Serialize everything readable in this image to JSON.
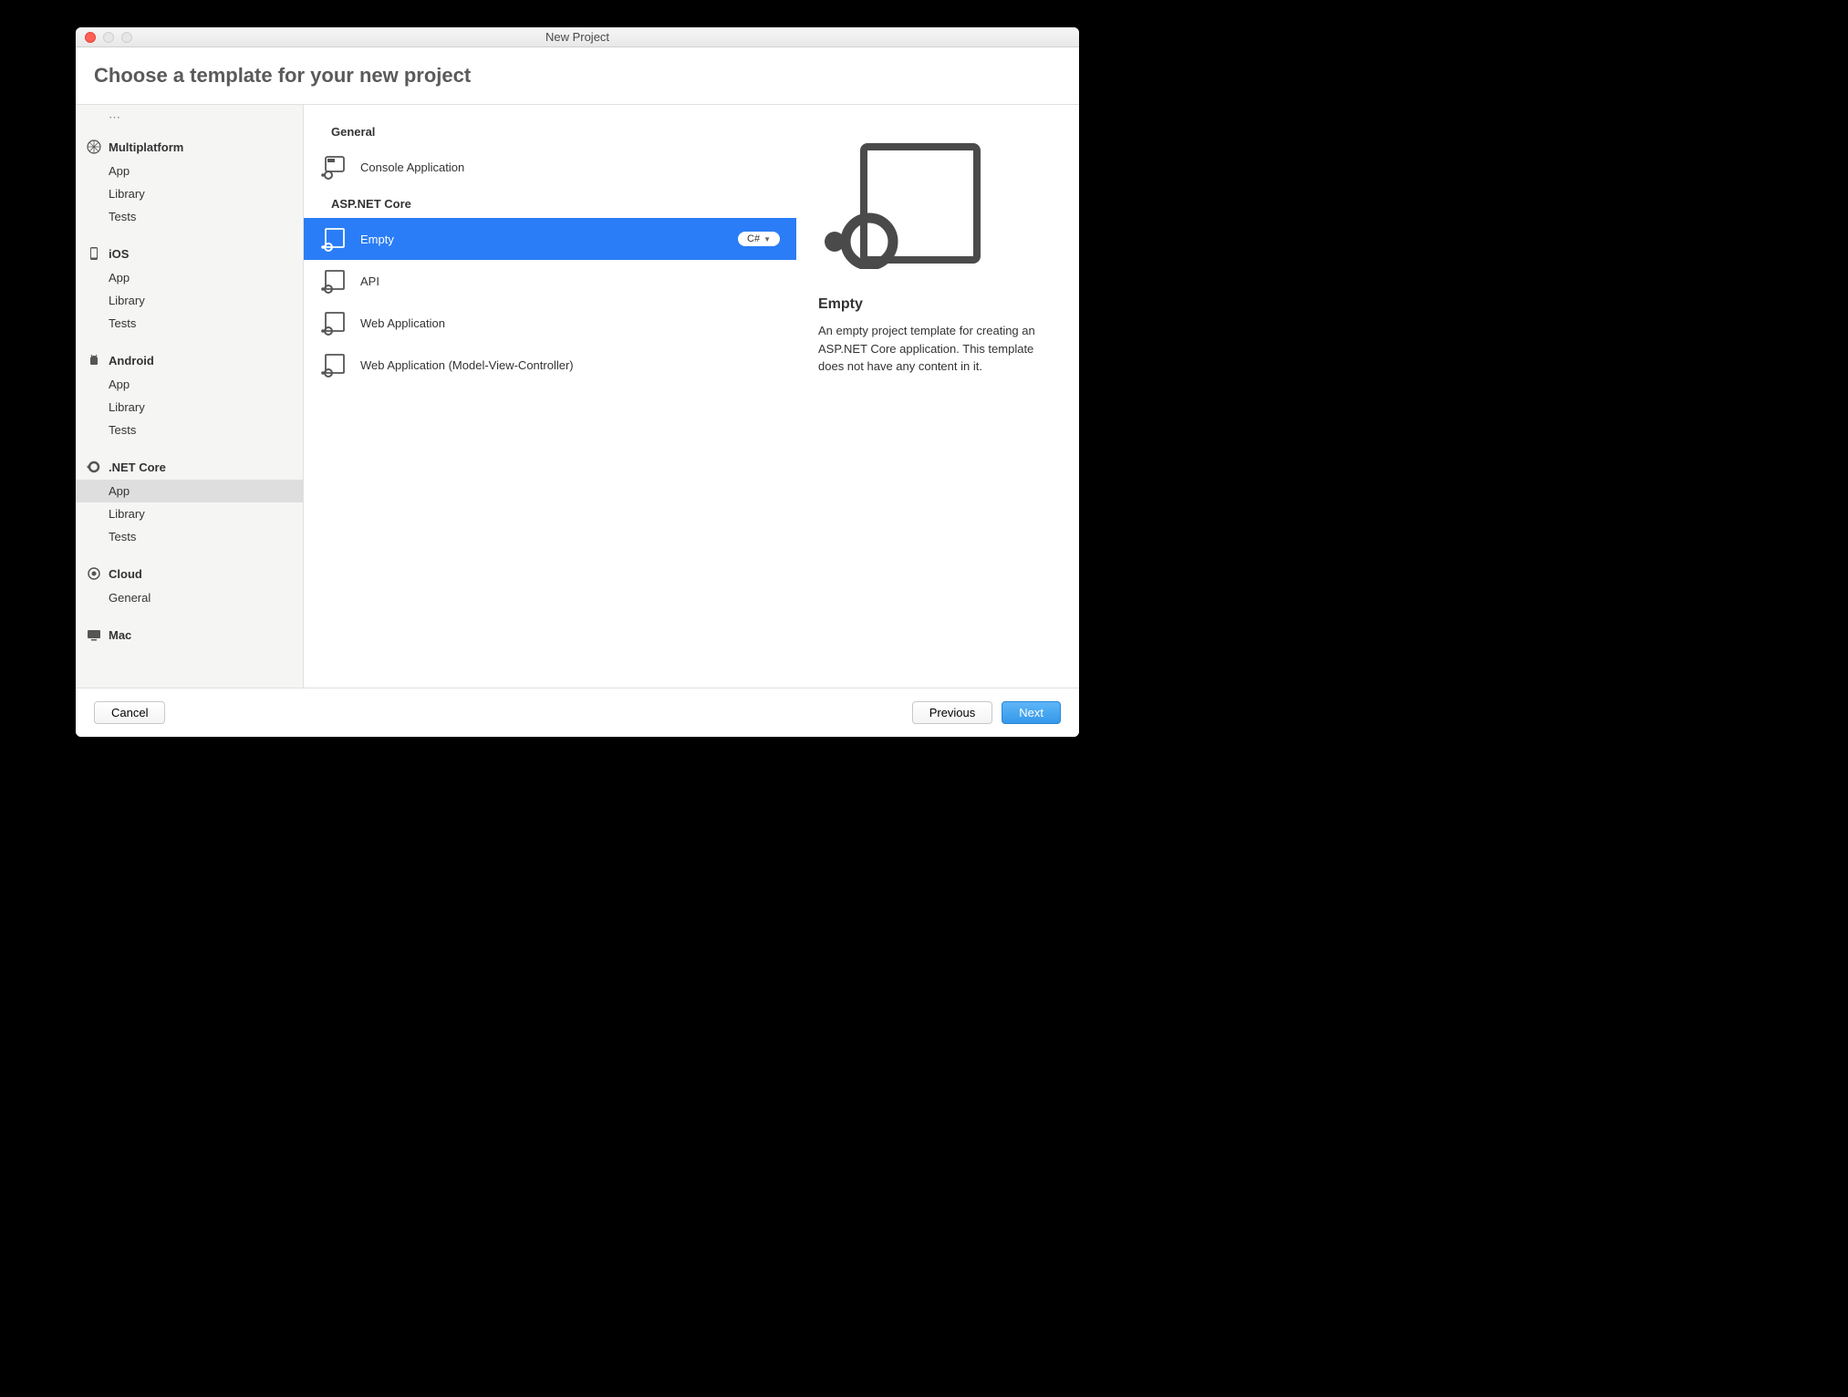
{
  "window": {
    "title": "New Project"
  },
  "header": {
    "title": "Choose a template for your new project"
  },
  "sidebar": {
    "categories": [
      {
        "name": "Multiplatform",
        "icon": "multiplatform",
        "items": [
          "App",
          "Library",
          "Tests"
        ]
      },
      {
        "name": "iOS",
        "icon": "ios",
        "items": [
          "App",
          "Library",
          "Tests"
        ]
      },
      {
        "name": "Android",
        "icon": "android",
        "items": [
          "App",
          "Library",
          "Tests"
        ]
      },
      {
        "name": ".NET Core",
        "icon": "netcore",
        "items": [
          "App",
          "Library",
          "Tests"
        ],
        "selected_item": 0
      },
      {
        "name": "Cloud",
        "icon": "cloud",
        "items": [
          "General"
        ]
      },
      {
        "name": "Mac",
        "icon": "mac",
        "items": []
      }
    ]
  },
  "templates": {
    "sections": [
      {
        "title": "General",
        "items": [
          {
            "label": "Console Application",
            "icon": "console"
          }
        ]
      },
      {
        "title": "ASP.NET Core",
        "items": [
          {
            "label": "Empty",
            "icon": "web",
            "selected": true,
            "lang": "C#"
          },
          {
            "label": "API",
            "icon": "web"
          },
          {
            "label": "Web Application",
            "icon": "web"
          },
          {
            "label": "Web Application (Model-View-Controller)",
            "icon": "web"
          }
        ]
      }
    ]
  },
  "detail": {
    "title": "Empty",
    "description": "An empty project template for creating an ASP.NET Core application. This template does not have any content in it."
  },
  "footer": {
    "cancel": "Cancel",
    "previous": "Previous",
    "next": "Next"
  }
}
